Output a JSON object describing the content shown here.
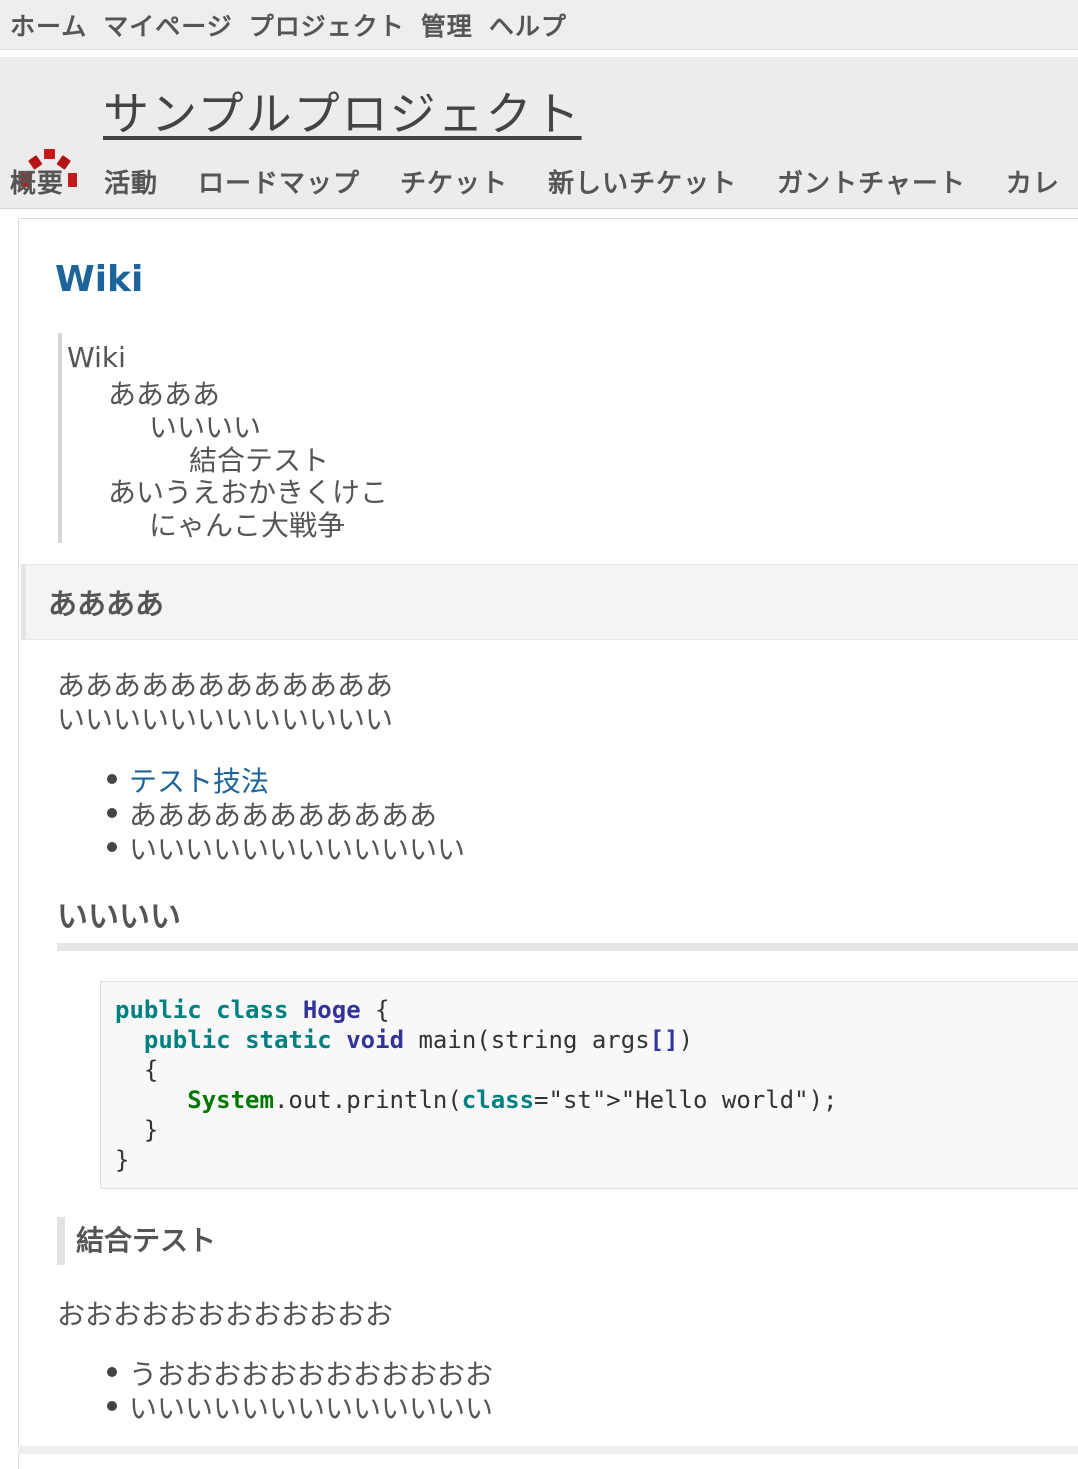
{
  "top_menu": [
    "ホーム",
    "マイページ",
    "プロジェクト",
    "管理",
    "ヘルプ"
  ],
  "project": {
    "title": "サンプルプロジェクト"
  },
  "main_menu": [
    "概要",
    "活動",
    "ロードマップ",
    "チケット",
    "新しいチケット",
    "ガントチャート",
    "カレ"
  ],
  "wiki": {
    "title": "Wiki",
    "toc": [
      "Wiki",
      "ああああ",
      "いいいい",
      "結合テスト",
      "あいうえおかきくけこ",
      "にゃんこ大戦争"
    ],
    "section1": {
      "heading": "ああああ",
      "para1": "ああああああああああああ",
      "para2": "いいいいいいいいいいいい",
      "list": [
        "テスト技法",
        "あああああああああああ",
        "いいいいいいいいいいいい"
      ]
    },
    "section2": {
      "heading": "いいいい",
      "code_lines": [
        "public class Hoge {",
        "  public static void main(string args[])",
        "  {",
        "     System.out.println(\"Hello world\");",
        "  }",
        "}"
      ]
    },
    "section3": {
      "heading": "結合テスト",
      "para": "おおおおおおおおおおおお",
      "list": [
        "うおおおおおおおおおおおお",
        "いいいいいいいいいいいいい"
      ]
    }
  }
}
